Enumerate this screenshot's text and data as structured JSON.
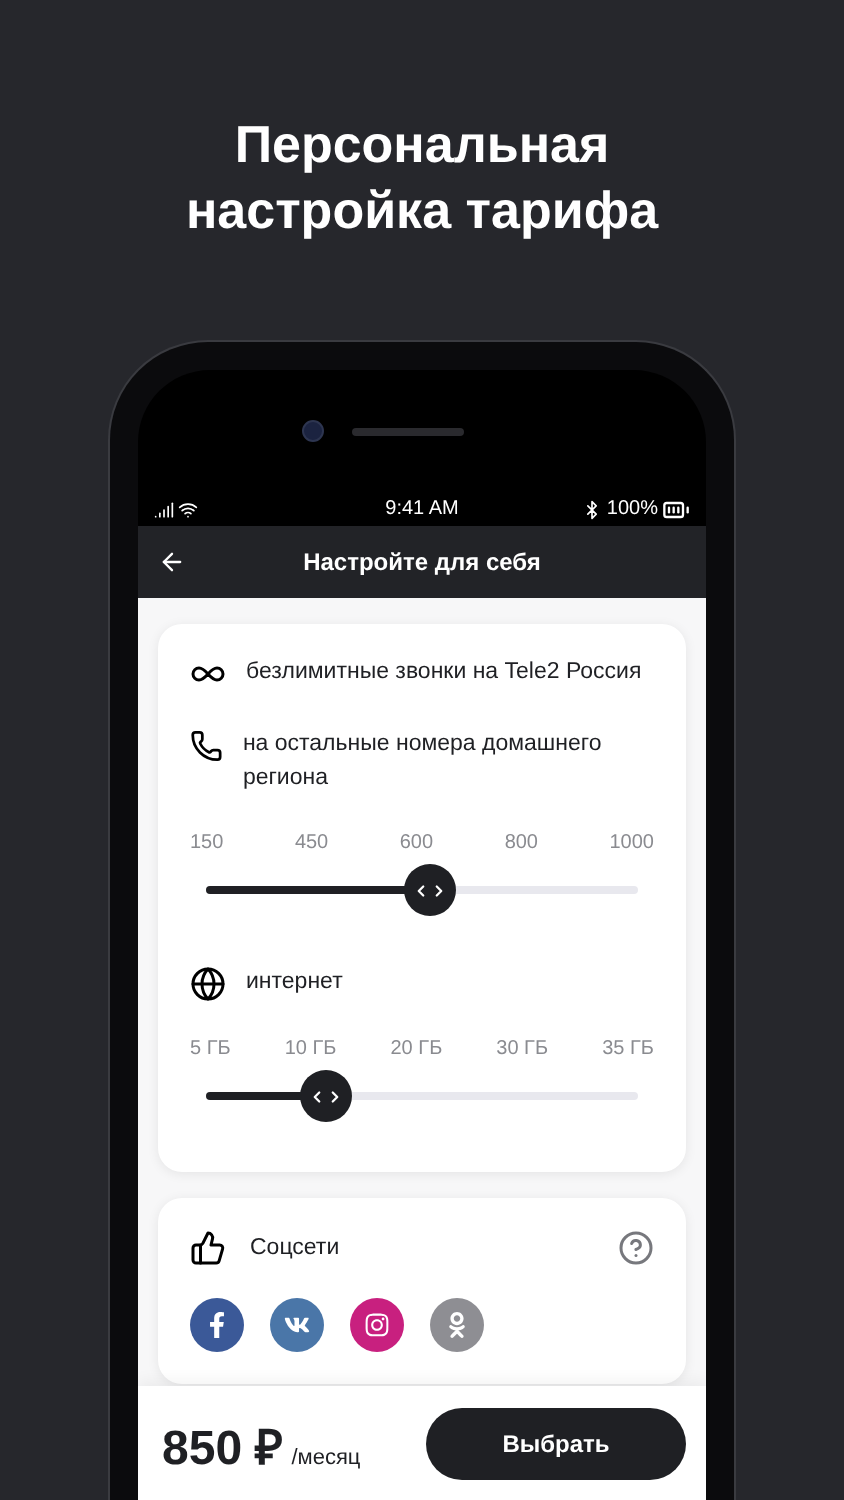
{
  "headline": "Персональная настройка тарифа",
  "status_bar": {
    "time": "9:41 AM",
    "battery": "100%"
  },
  "nav": {
    "title": "Настройте для себя"
  },
  "plan_card": {
    "notes": [
      {
        "text": "безлимитные звонки на Tele2 Россия"
      }
    ],
    "sliders": [
      {
        "label": "на остальные номера домашнего региона",
        "ticks": [
          "150",
          "450",
          "600",
          "800",
          "1000"
        ],
        "level": 0.52
      },
      {
        "label": "интернет",
        "ticks": [
          "5 ГБ",
          "10 ГБ",
          "20 ГБ",
          "30 ГБ",
          "35 ГБ"
        ],
        "level": 0.28
      }
    ]
  },
  "social_card": {
    "title": "Соцсети",
    "networks": [
      {
        "color": "#3b5998"
      },
      {
        "color": "#4a76a8"
      },
      {
        "color": "#c8207f"
      },
      {
        "color": "#8e8e93"
      }
    ]
  },
  "footer": {
    "price": "850 ₽",
    "period": "/месяц",
    "button": "Выбрать"
  }
}
